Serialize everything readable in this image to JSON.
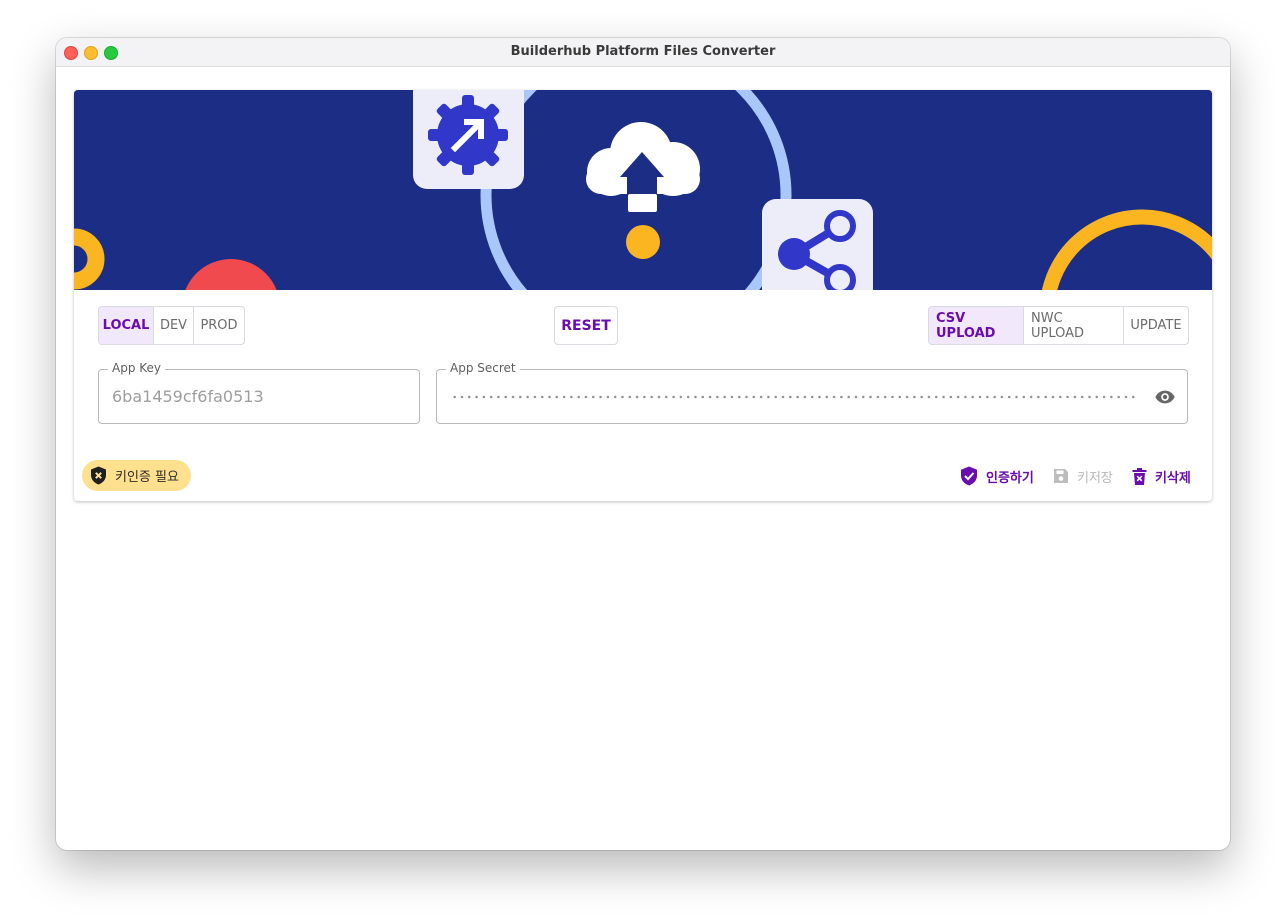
{
  "window": {
    "title": "Builderhub Platform Files Converter"
  },
  "environment_tabs": [
    {
      "label": "LOCAL",
      "active": true
    },
    {
      "label": "DEV",
      "active": false
    },
    {
      "label": "PROD",
      "active": false
    }
  ],
  "reset_label": "RESET",
  "mode_tabs": [
    {
      "label": "CSV UPLOAD",
      "active": true
    },
    {
      "label": "NWC UPLOAD",
      "active": false
    },
    {
      "label": "UPDATE",
      "active": false
    }
  ],
  "app_key": {
    "label": "App Key",
    "value": "6ba1459cf6fa0513"
  },
  "app_secret": {
    "label": "App Secret"
  },
  "status_chip": {
    "label": "키인증 필요"
  },
  "actions": {
    "authenticate": "인증하기",
    "save_key": "키저장",
    "delete_key": "키삭제"
  },
  "colors": {
    "banner": "#1b2d85",
    "accent": "#6a0dad",
    "chip": "#ffe08f"
  }
}
